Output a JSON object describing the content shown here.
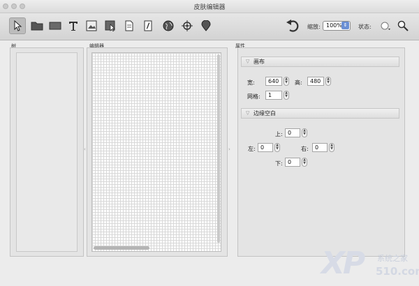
{
  "window": {
    "title": "皮肤编辑器"
  },
  "toolbar": {
    "tools": [
      {
        "icon": "arrow-pointer-icon",
        "active": true
      },
      {
        "icon": "folder-icon"
      },
      {
        "icon": "rectangle-icon"
      },
      {
        "icon": "text-t-icon"
      },
      {
        "icon": "image-icon"
      },
      {
        "icon": "image-cursor-icon"
      },
      {
        "icon": "document-icon"
      },
      {
        "icon": "script-document-icon"
      },
      {
        "icon": "globe-icon"
      },
      {
        "icon": "crosshair-icon"
      },
      {
        "icon": "map-pin-icon"
      }
    ],
    "undo_icon": "undo-icon",
    "zoom_label": "缩放:",
    "zoom_value": "100%",
    "state_label": "状态:",
    "state_icon": "state-dot-icon",
    "search_icon": "magnifier-icon"
  },
  "panels": {
    "tree_label": "树",
    "editor_label": "编辑器",
    "properties_label": "属性"
  },
  "properties": {
    "canvas_section": {
      "title": "画布",
      "width_label": "宽:",
      "width_value": "640",
      "height_label": "高:",
      "height_value": "480",
      "grid_label": "网格:",
      "grid_value": "1"
    },
    "margin_section": {
      "title": "边缘空白",
      "top_label": "上:",
      "top_value": "0",
      "left_label": "左:",
      "left_value": "0",
      "right_label": "右:",
      "right_value": "0",
      "bottom_label": "下:",
      "bottom_value": "0"
    }
  },
  "watermark": {
    "logo_text": "XP",
    "site_text": "系统之家",
    "domain_text": "510.com"
  }
}
